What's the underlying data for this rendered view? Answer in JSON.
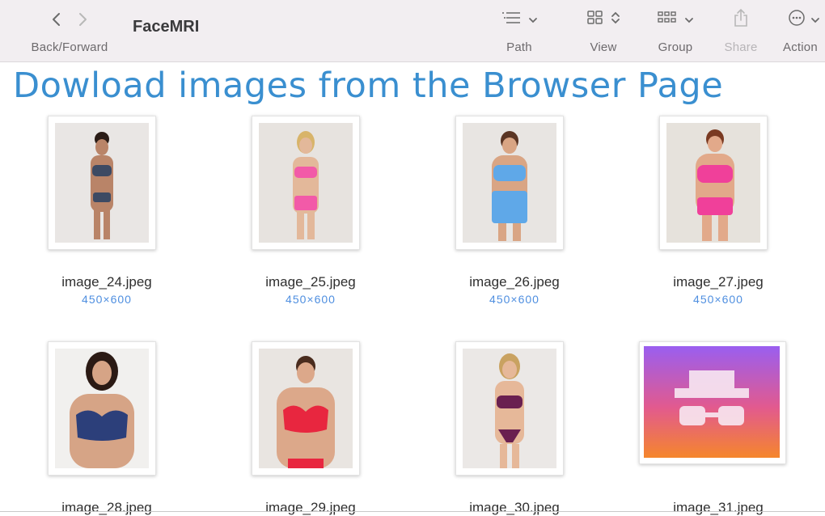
{
  "toolbar": {
    "nav_label": "Back/Forward",
    "title": "FaceMRI",
    "path_label": "Path",
    "view_label": "View",
    "group_label": "Group",
    "share_label": "Share",
    "action_label": "Action"
  },
  "banner": {
    "text": "Dowload images from the Browser Page"
  },
  "files": [
    {
      "name": "image_24.jpeg",
      "dims": "450×600"
    },
    {
      "name": "image_25.jpeg",
      "dims": "450×600"
    },
    {
      "name": "image_26.jpeg",
      "dims": "450×600"
    },
    {
      "name": "image_27.jpeg",
      "dims": "450×600"
    },
    {
      "name": "image_28.jpeg"
    },
    {
      "name": "image_29.jpeg"
    },
    {
      "name": "image_30.jpeg"
    },
    {
      "name": "image_31.jpeg"
    }
  ],
  "colors": {
    "banner_text": "#3a8fd0",
    "dims_text": "#4f8fe0",
    "toolbar_bg": "#f2eef1",
    "outfit_24": "#3d4a63",
    "outfit_25": "#f25aa8",
    "outfit_26": "#5fa8e8",
    "outfit_27": "#f0409a",
    "outfit_28": "#2c3f7a",
    "outfit_29": "#e8263f",
    "outfit_30": "#6a2050"
  },
  "icons": [
    "chevron-left-icon",
    "chevron-right-icon",
    "list-icon",
    "grid-icon",
    "group-icon",
    "share-icon",
    "more-icon",
    "incognito-icon"
  ]
}
